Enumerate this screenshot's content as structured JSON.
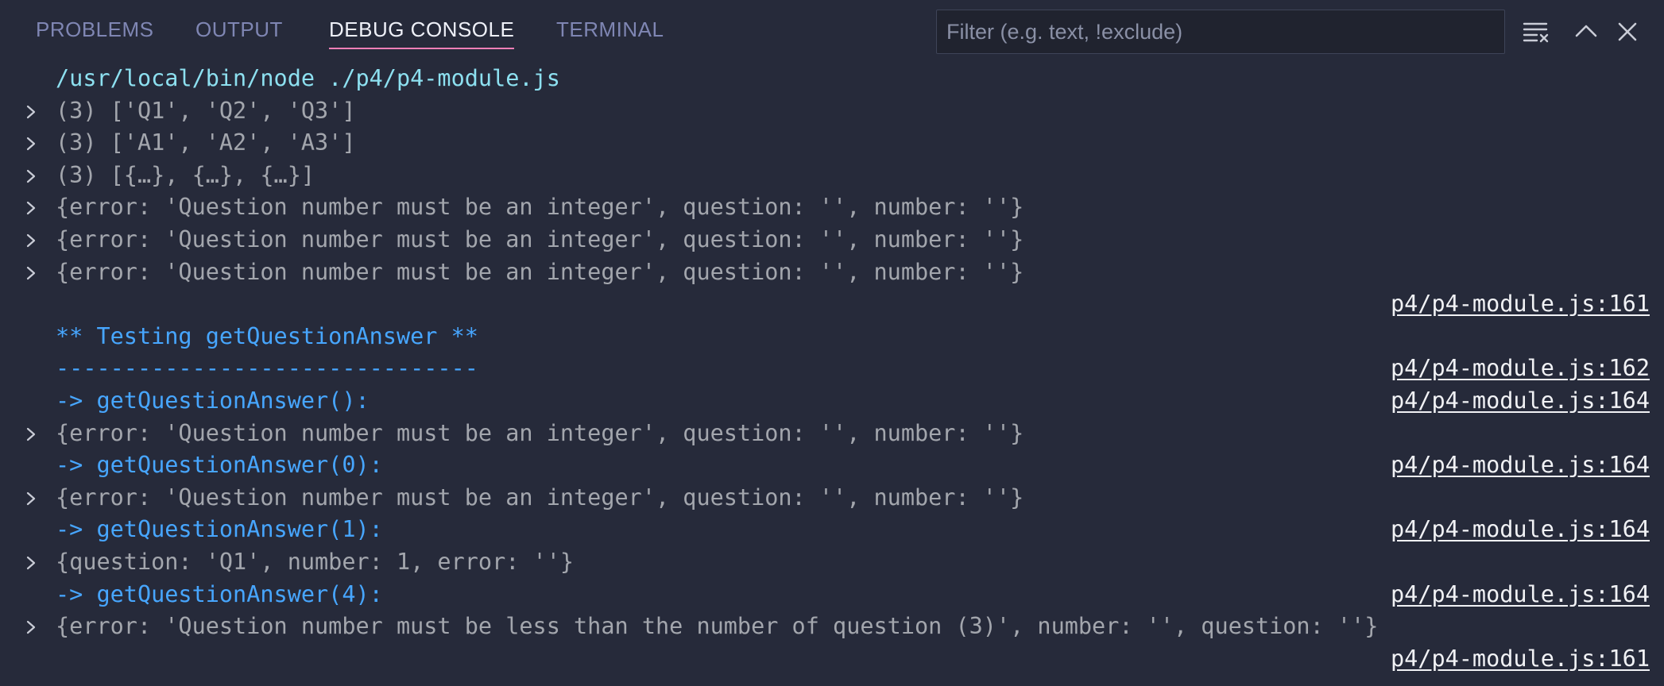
{
  "tabs": [
    {
      "label": "PROBLEMS",
      "active": false
    },
    {
      "label": "OUTPUT",
      "active": false
    },
    {
      "label": "DEBUG CONSOLE",
      "active": true
    },
    {
      "label": "TERMINAL",
      "active": false
    }
  ],
  "filter": {
    "placeholder": "Filter (e.g. text, !exclude)",
    "value": ""
  },
  "toolbar": {
    "clear_icon": "clear-all-icon",
    "collapse_icon": "chevron-up-icon",
    "close_icon": "close-icon"
  },
  "colors": {
    "background": "#262a3a",
    "active_tab_underline": "#f47fb6",
    "command_text": "#8de0f0",
    "log_text": "#47a6ff",
    "object_text": "#a3a6ad",
    "source_link": "#f1f2f5"
  },
  "console": {
    "lines": [
      {
        "text": "/usr/local/bin/node ./p4/p4-module.js",
        "kind": "cmd",
        "expandable": false,
        "source": ""
      },
      {
        "text": "(3) ['Q1', 'Q2', 'Q3']",
        "kind": "obj",
        "expandable": true,
        "source": ""
      },
      {
        "text": "(3) ['A1', 'A2', 'A3']",
        "kind": "obj",
        "expandable": true,
        "source": ""
      },
      {
        "text": "(3) [{…}, {…}, {…}]",
        "kind": "obj",
        "expandable": true,
        "source": ""
      },
      {
        "text": "{error: 'Question number must be an integer', question: '', number: ''}",
        "kind": "obj",
        "expandable": true,
        "source": ""
      },
      {
        "text": "{error: 'Question number must be an integer', question: '', number: ''}",
        "kind": "obj",
        "expandable": true,
        "source": ""
      },
      {
        "text": "{error: 'Question number must be an integer', question: '', number: ''}",
        "kind": "obj",
        "expandable": true,
        "source": ""
      },
      {
        "text": "",
        "kind": "blank",
        "expandable": false,
        "source": "p4/p4-module.js:161"
      },
      {
        "text": "** Testing getQuestionAnswer **",
        "kind": "blue",
        "expandable": false,
        "source": ""
      },
      {
        "text": "-------------------------------",
        "kind": "blue",
        "expandable": false,
        "source": "p4/p4-module.js:162"
      },
      {
        "text": "-> getQuestionAnswer():",
        "kind": "blue",
        "expandable": false,
        "source": "p4/p4-module.js:164"
      },
      {
        "text": "{error: 'Question number must be an integer', question: '', number: ''}",
        "kind": "obj",
        "expandable": true,
        "source": ""
      },
      {
        "text": "-> getQuestionAnswer(0):",
        "kind": "blue",
        "expandable": false,
        "source": "p4/p4-module.js:164"
      },
      {
        "text": "{error: 'Question number must be an integer', question: '', number: ''}",
        "kind": "obj",
        "expandable": true,
        "source": ""
      },
      {
        "text": "-> getQuestionAnswer(1):",
        "kind": "blue",
        "expandable": false,
        "source": "p4/p4-module.js:164"
      },
      {
        "text": "{question: 'Q1', number: 1, error: ''}",
        "kind": "obj",
        "expandable": true,
        "source": ""
      },
      {
        "text": "-> getQuestionAnswer(4):",
        "kind": "blue",
        "expandable": false,
        "source": "p4/p4-module.js:164"
      },
      {
        "text": "{error: 'Question number must be less than the number of question (3)', number: '', question: ''}",
        "kind": "obj",
        "expandable": true,
        "source": ""
      },
      {
        "text": "",
        "kind": "blank",
        "expandable": false,
        "source": "p4/p4-module.js:161"
      }
    ]
  }
}
